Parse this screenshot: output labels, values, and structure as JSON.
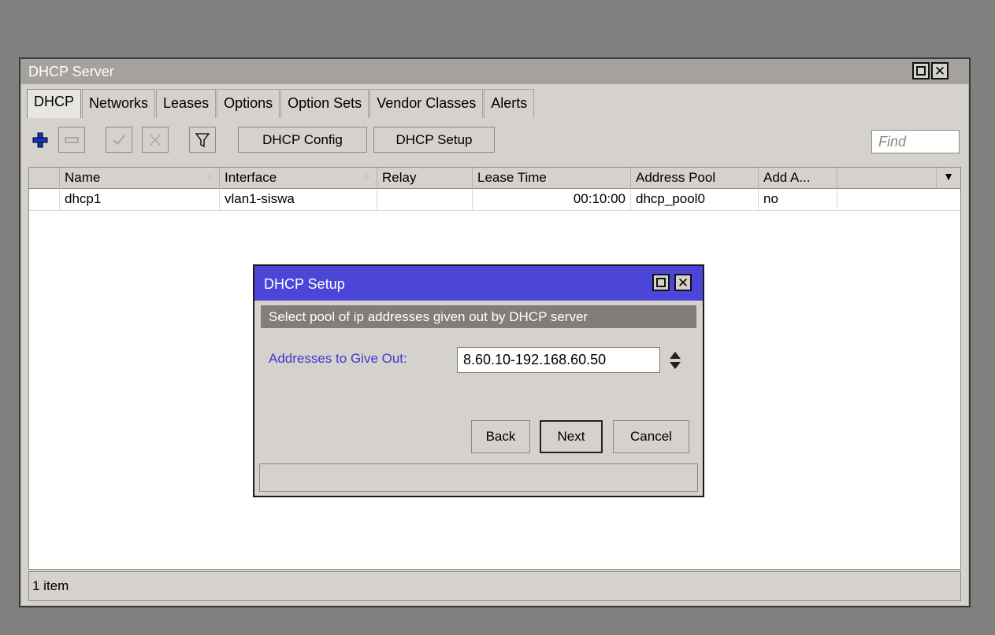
{
  "window": {
    "title": "DHCP Server",
    "tabs": [
      "DHCP",
      "Networks",
      "Leases",
      "Options",
      "Option Sets",
      "Vendor Classes",
      "Alerts"
    ],
    "active_tab": "DHCP",
    "toolbar": {
      "dhcp_config": "DHCP Config",
      "dhcp_setup": "DHCP Setup",
      "find_placeholder": "Find"
    },
    "table": {
      "columns": [
        "Name",
        "Interface",
        "Relay",
        "Lease Time",
        "Address Pool",
        "Add A..."
      ],
      "rows": [
        {
          "name": "dhcp1",
          "interface": "vlan1-siswa",
          "relay": "",
          "lease_time": "00:10:00",
          "address_pool": "dhcp_pool0",
          "add_a": "no"
        }
      ]
    },
    "status": "1 item"
  },
  "dialog": {
    "title": "DHCP Setup",
    "description": "Select pool of ip addresses given out by DHCP server",
    "field_label": "Addresses to Give Out:",
    "field_value": "8.60.10-192.168.60.50",
    "buttons": {
      "back": "Back",
      "next": "Next",
      "cancel": "Cancel"
    }
  },
  "colors": {
    "dialog_title": "#4b46d8",
    "field_label": "#3e3ad2",
    "add_icon": "#1233c8"
  }
}
